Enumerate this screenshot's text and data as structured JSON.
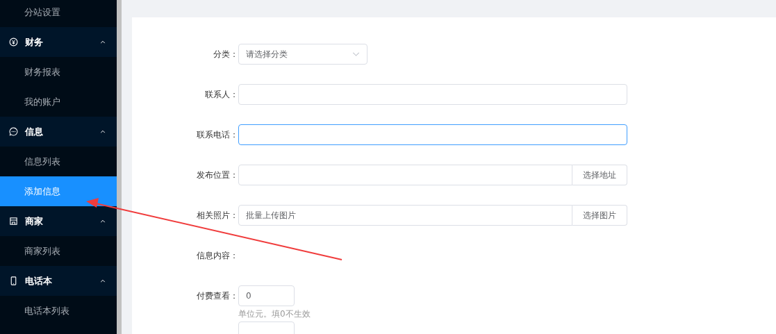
{
  "sidebar": {
    "items": [
      {
        "kind": "item",
        "label": "分站设置",
        "selected": false
      },
      {
        "kind": "group",
        "label": "财务",
        "expanded": true,
        "children": [
          {
            "label": "财务报表",
            "selected": false
          },
          {
            "label": "我的账户",
            "selected": false
          }
        ]
      },
      {
        "kind": "group",
        "label": "信息",
        "expanded": true,
        "children": [
          {
            "label": "信息列表",
            "selected": false
          },
          {
            "label": "添加信息",
            "selected": true
          }
        ]
      },
      {
        "kind": "group",
        "label": "商家",
        "expanded": true,
        "children": [
          {
            "label": "商家列表",
            "selected": false
          }
        ]
      },
      {
        "kind": "group",
        "label": "电话本",
        "expanded": true,
        "children": [
          {
            "label": "电话本列表",
            "selected": false
          }
        ]
      }
    ]
  },
  "form": {
    "fields": [
      {
        "kind": "select",
        "label": "分类：",
        "placeholder": "请选择分类"
      },
      {
        "kind": "input",
        "label": "联系人：",
        "focused": false
      },
      {
        "kind": "input",
        "label": "联系电话：",
        "focused": true
      },
      {
        "kind": "addon",
        "label": "发布位置：",
        "button": "选择地址"
      },
      {
        "kind": "addon",
        "label": "相关照片：",
        "placeholder": "批量上传图片",
        "button": "选择图片"
      },
      {
        "kind": "static",
        "label": "信息内容："
      },
      {
        "kind": "number",
        "label": "付费查看：",
        "value": "0",
        "help": "单位元。填0不生效"
      },
      {
        "kind": "number"
      }
    ]
  }
}
